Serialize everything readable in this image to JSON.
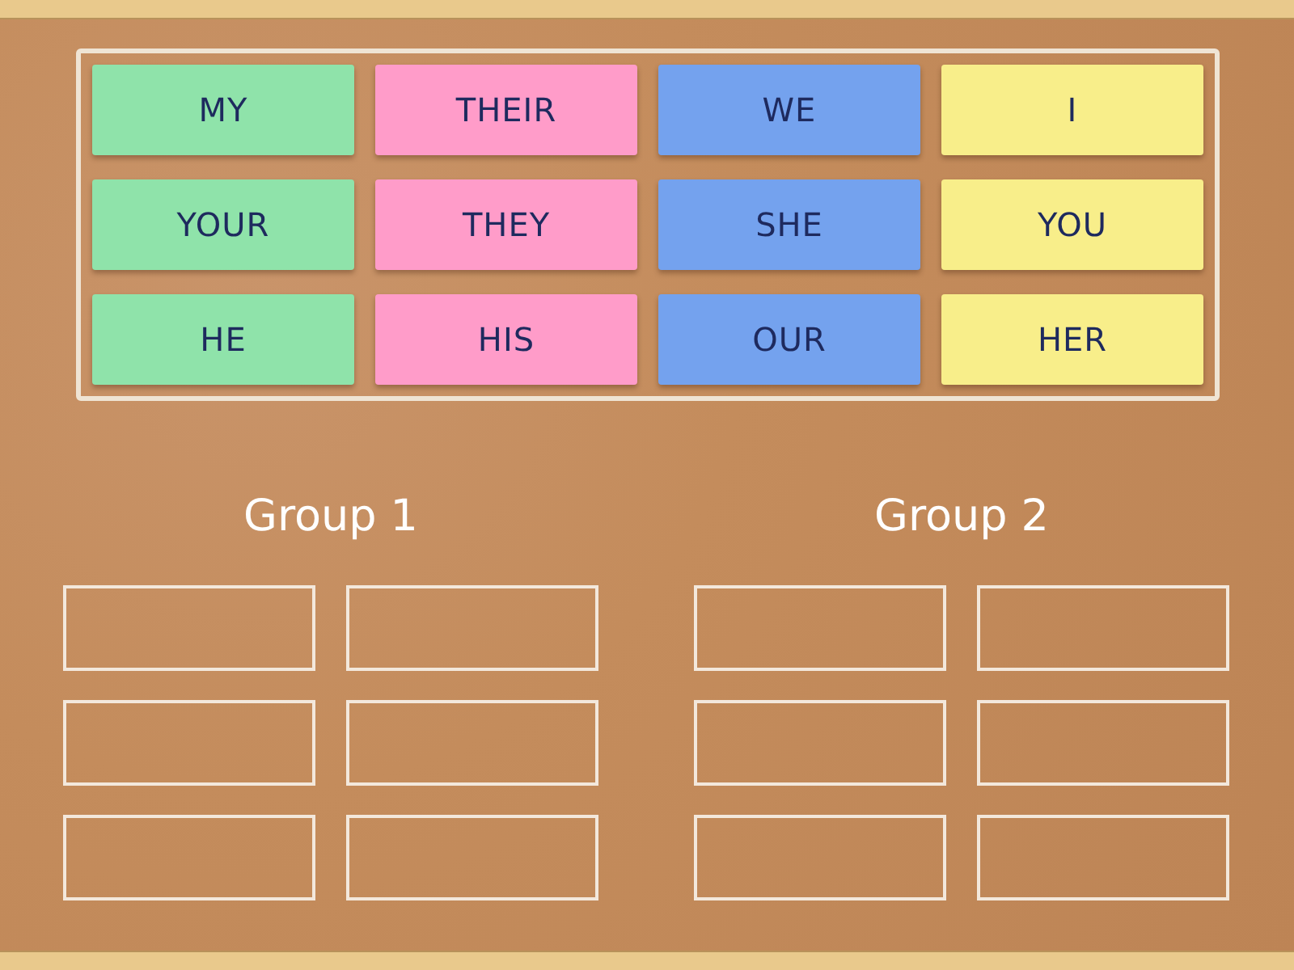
{
  "cards": [
    {
      "text": "MY",
      "color": "#8fe3aa"
    },
    {
      "text": "THEIR",
      "color": "#ff9cc9"
    },
    {
      "text": "WE",
      "color": "#74a2ee"
    },
    {
      "text": "I",
      "color": "#f8ee8a"
    },
    {
      "text": "YOUR",
      "color": "#8fe3aa"
    },
    {
      "text": "THEY",
      "color": "#ff9cc9"
    },
    {
      "text": "SHE",
      "color": "#74a2ee"
    },
    {
      "text": "YOU",
      "color": "#f8ee8a"
    },
    {
      "text": "HE",
      "color": "#8fe3aa"
    },
    {
      "text": "HIS",
      "color": "#ff9cc9"
    },
    {
      "text": "OUR",
      "color": "#74a2ee"
    },
    {
      "text": "HER",
      "color": "#f8ee8a"
    }
  ],
  "groups": [
    {
      "title": "Group 1"
    },
    {
      "title": "Group 2"
    }
  ]
}
